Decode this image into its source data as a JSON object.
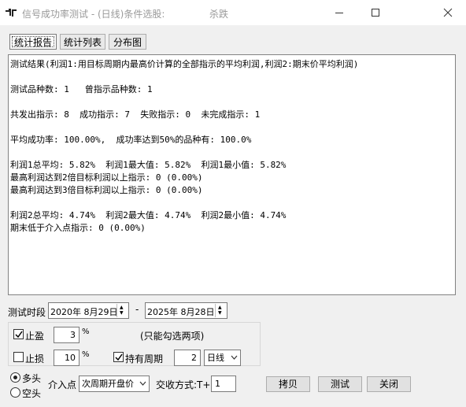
{
  "window": {
    "title": "信号成功率测试 - (日线)条件选股:",
    "title_extra": "杀跌"
  },
  "tabs": [
    {
      "label": "统计报告",
      "active": true
    },
    {
      "label": "统计列表",
      "active": false
    },
    {
      "label": "分布图",
      "active": false
    }
  ],
  "report": {
    "lines": [
      "测试结果(利润1:用目标周期内最高价计算的全部指示的平均利润,利润2:期末价平均利润)",
      "",
      "测试品种数: 1   曾指示品种数: 1",
      "",
      "共发出指示: 8  成功指示: 7  失败指示: 0  未完成指示: 1",
      "",
      "平均成功率: 100.00%,  成功率达到50%的品种有: 100.0%",
      "",
      "利润1总平均: 5.82%  利润1最大值: 5.82%  利润1最小值: 5.82%",
      "最高利润达到2倍目标利润以上指示: 0 (0.00%)",
      "最高利润达到3倍目标利润以上指示: 0 (0.00%)",
      "",
      "利润2总平均: 4.74%  利润2最大值: 4.74%  利润2最小值: 4.74%",
      "期末低于介入点指示: 0 (0.00%)"
    ]
  },
  "test_period": {
    "label": "测试时段",
    "start_date": "2020年 8月29日",
    "separator": "-",
    "end_date": "2025年 8月28日"
  },
  "options": {
    "take_profit": {
      "label": "止盈",
      "checked": true,
      "value": "3",
      "unit": "%"
    },
    "stop_loss": {
      "label": "止损",
      "checked": false,
      "value": "10",
      "unit": "%"
    },
    "note": "(只能勾选两项)",
    "hold_period": {
      "label": "持有周期",
      "checked": true,
      "value": "2",
      "unit_selected": "日线"
    }
  },
  "direction": {
    "long_label": "多头",
    "long_selected": true,
    "short_label": "空头",
    "short_selected": false
  },
  "entry": {
    "label": "介入点",
    "selected": "次周期开盘价"
  },
  "trade_mode": {
    "label": "交收方式:T+",
    "value": "1"
  },
  "buttons": {
    "copy": "拷贝",
    "test": "测试",
    "close": "关闭"
  }
}
